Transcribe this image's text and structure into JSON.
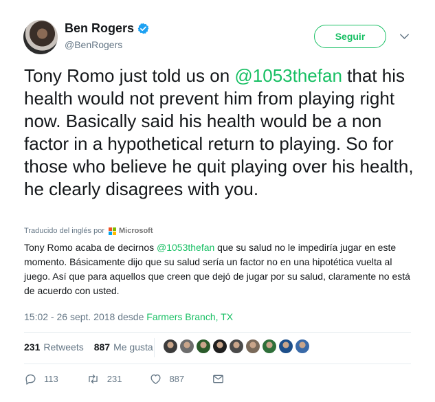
{
  "author": {
    "name": "Ben Rogers",
    "handle": "@BenRogers",
    "verified": true
  },
  "follow_button": {
    "label": "Seguir"
  },
  "tweet": {
    "text_parts": [
      "Tony Romo just told us on ",
      "@1053thefan",
      " that his health would not prevent him from playing right now. Basically said his health would be a non factor in a hypothetical return to playing. So for those who believe he quit playing over his health, he clearly disagrees with you."
    ]
  },
  "translation": {
    "credit_label": "Traducido del inglés por",
    "provider": "Microsoft",
    "text_parts": [
      "Tony Romo acaba de decirnos ",
      "@1053thefan",
      " que su salud no le impediría jugar en este momento. Básicamente dijo que su salud sería un factor no en una hipotética vuelta al juego. Así que para aquellos que creen que dejó de jugar por su salud, claramente no está de acuerdo con usted."
    ]
  },
  "meta": {
    "timestamp": "15:02 - 26 sept. 2018",
    "from_label": "desde",
    "location": "Farmers Branch, TX"
  },
  "stats": {
    "retweets_count": "231",
    "retweets_label": "Retweets",
    "likes_count": "887",
    "likes_label": "Me gusta"
  },
  "liker_avatars": [
    "#3b3b3b",
    "#6d6d6d",
    "#2a5b2a",
    "#1f1f1f",
    "#4a4a4a",
    "#7a6a5a",
    "#2f6f3a",
    "#1d4f8a",
    "#3a6aa8"
  ],
  "actions": {
    "reply_count": "113",
    "retweet_count": "231",
    "like_count": "887"
  },
  "colors": {
    "accent": "#17bf63",
    "text": "#14171a",
    "muted": "#657786",
    "verified": "#1da1f2"
  }
}
